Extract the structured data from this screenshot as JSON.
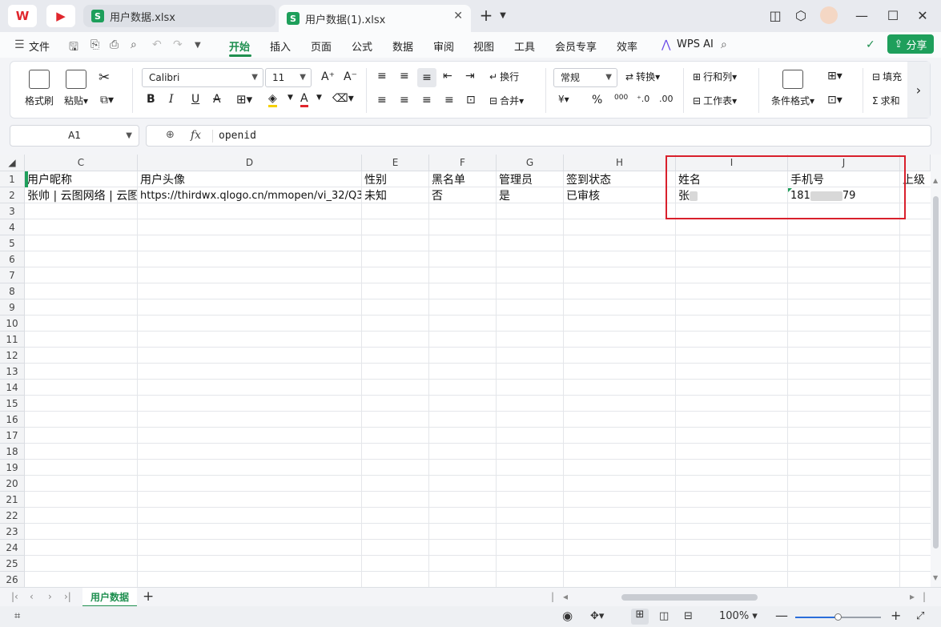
{
  "titlebar": {
    "tabs": [
      {
        "label": "用户数据.xlsx",
        "active": false
      },
      {
        "label": "用户数据(1).xlsx",
        "active": true
      }
    ],
    "new_tab": "+",
    "file_icon_letter": "S",
    "wps_letter": "W"
  },
  "menubar": {
    "file": "文件",
    "items": [
      "开始",
      "插入",
      "页面",
      "公式",
      "数据",
      "审阅",
      "视图",
      "工具",
      "会员专享",
      "效率"
    ],
    "wps_ai": "WPS AI",
    "share": "分享"
  },
  "ribbon": {
    "format_painter": "格式刷",
    "paste": "粘贴",
    "font_name": "Calibri",
    "font_size": "11",
    "wrap": "换行",
    "merge": "合并",
    "number_format": "常规",
    "convert": "转换",
    "row_col": "行和列",
    "worksheet": "工作表",
    "cond_format": "条件格式",
    "fill": "填充",
    "sum": "求和",
    "bold": "B",
    "italic": "I",
    "underline": "U",
    "strike": "A",
    "currency": "¥",
    "percent": "%",
    "thousands": "000"
  },
  "formula_bar": {
    "cell_ref": "A1",
    "fx": "fx",
    "value": "openid"
  },
  "grid": {
    "columns": [
      "C",
      "D",
      "E",
      "F",
      "G",
      "H",
      "I",
      "J"
    ],
    "rows": [
      "1",
      "2",
      "3",
      "4",
      "5",
      "6",
      "7",
      "8",
      "9",
      "10",
      "11",
      "12",
      "13",
      "14",
      "15",
      "16",
      "17",
      "18",
      "19",
      "20",
      "21",
      "22",
      "23",
      "24",
      "25",
      "26"
    ],
    "header_row": [
      "用户昵称",
      "用户头像",
      "性别",
      "黑名单",
      "管理员",
      "签到状态",
      "姓名",
      "手机号",
      "上级"
    ],
    "data_row": {
      "nickname": "张帅 | 云图网络 | 云图",
      "avatar": "https://thirdwx.qlogo.cn/mmopen/vi_32/Q3",
      "gender": "未知",
      "blacklist": "否",
      "admin": "是",
      "signin": "已审核",
      "name_visible": "张",
      "phone_prefix": "181",
      "phone_suffix": "79"
    }
  },
  "sheets": {
    "tabs": [
      "用户数据"
    ],
    "add": "+"
  },
  "statusbar": {
    "zoom": "100%"
  },
  "colors": {
    "accent": "#1e9f5b",
    "highlight_box": "#d9202c"
  }
}
